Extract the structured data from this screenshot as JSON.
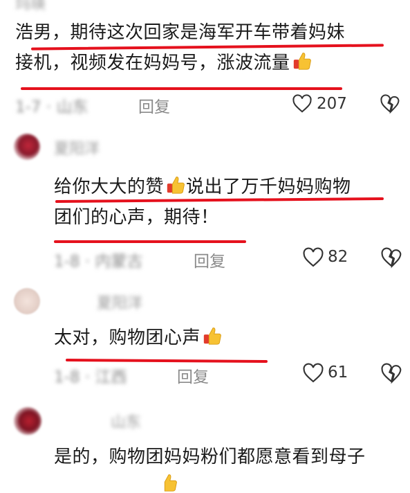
{
  "comments": [
    {
      "username": "玛瑛",
      "text_lines": [
        "浩男，期待这次回家是海军开车带着妈妹",
        "接机，视频发在妈妈号，涨波流量"
      ],
      "meta_blurred": "1-7 · 山东",
      "reply_label": "回复",
      "like_count": "207"
    },
    {
      "username": "夏阳洋",
      "text_lines": [
        "给你大大的赞",
        "说出了万千妈妈购物",
        "团们的心声，期待！"
      ],
      "meta_blurred": "1-8 · 内蒙古",
      "reply_label": "回复",
      "like_count": "82"
    },
    {
      "username": "夏阳洋",
      "text_lines": [
        "太对，购物团心声"
      ],
      "meta_blurred": "1-8 · 江西",
      "reply_label": "回复",
      "like_count": "61"
    },
    {
      "username": "山东",
      "text_lines": [
        "是的，购物团妈妈粉们都愿意看到母子"
      ]
    }
  ],
  "colors": {
    "underline": "#e5111d",
    "meta_gray": "#8a8a8a",
    "text": "#1a1a1a"
  },
  "icons": {
    "like": "heart-outline-icon",
    "dislike": "broken-heart-icon",
    "emoji": "thumbs-up-emoji-icon"
  }
}
